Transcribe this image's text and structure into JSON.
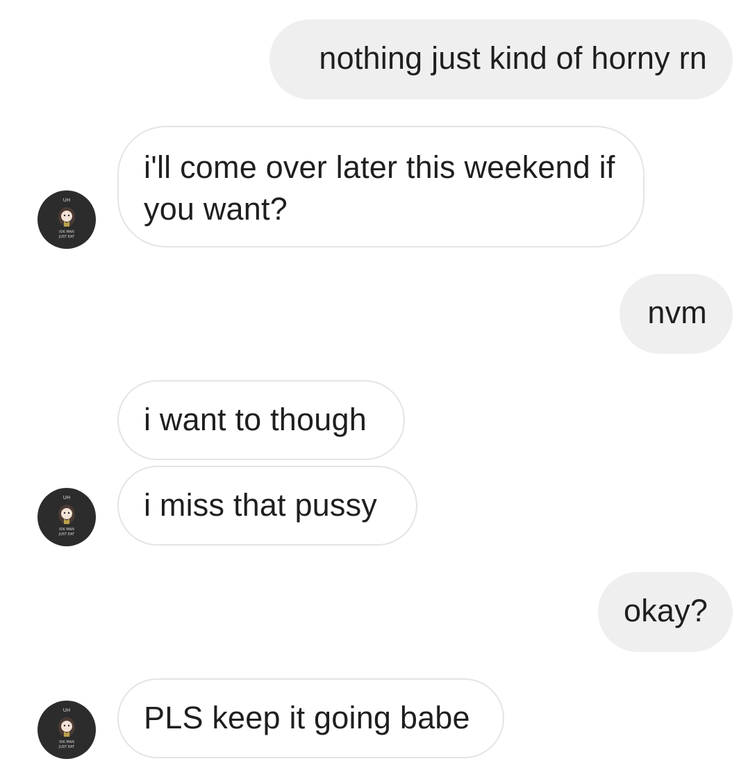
{
  "messages": [
    {
      "dir": "sent",
      "text": "nothing just kind of horny rn"
    },
    {
      "dir": "received",
      "text": "i'll come over later this weekend if you want?"
    },
    {
      "dir": "sent",
      "text": "nvm"
    },
    {
      "dir": "received",
      "text": "i want to though"
    },
    {
      "dir": "received",
      "text": "i miss that pussy"
    },
    {
      "dir": "sent",
      "text": "okay?"
    },
    {
      "dir": "received",
      "text": "PLS keep it going babe"
    }
  ],
  "avatar": {
    "icon": "contact-avatar-icon",
    "caption_top": "UH",
    "caption_bottom": "IDK MAN JUST EAT"
  },
  "colors": {
    "sent_bubble": "#efefef",
    "received_border": "#e4e4e4",
    "avatar_bg": "#2c2c2c",
    "text": "#1f1f1f"
  }
}
